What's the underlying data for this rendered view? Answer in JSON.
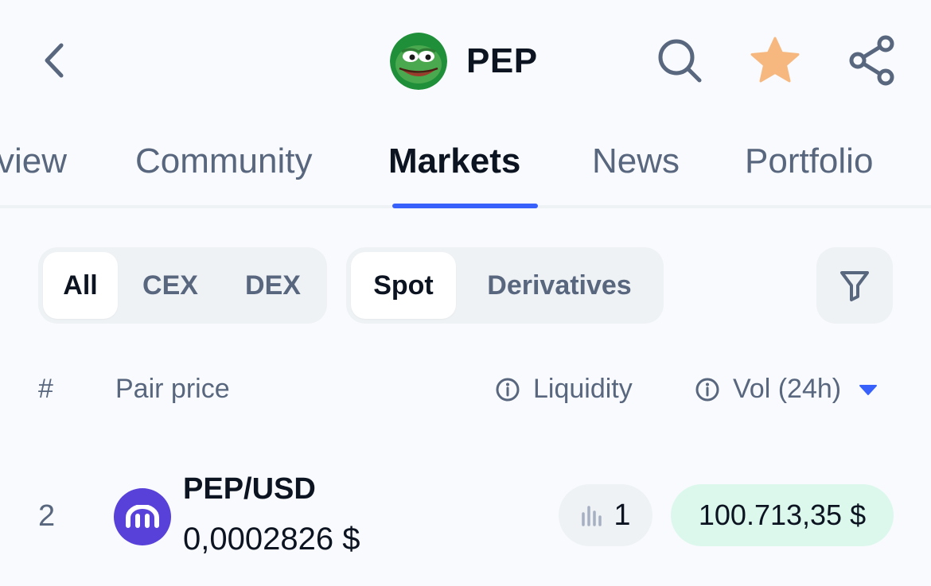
{
  "header": {
    "coin_symbol": "PEP"
  },
  "tabs": [
    {
      "label": "view",
      "active": false
    },
    {
      "label": "Community",
      "active": false
    },
    {
      "label": "Markets",
      "active": true
    },
    {
      "label": "News",
      "active": false
    },
    {
      "label": "Portfolio",
      "active": false
    }
  ],
  "filters": {
    "exchange_type": [
      "All",
      "CEX",
      "DEX"
    ],
    "exchange_type_selected": "All",
    "market_type": [
      "Spot",
      "Derivatives"
    ],
    "market_type_selected": "Spot"
  },
  "table": {
    "columns": {
      "rank": "#",
      "pair_price": "Pair price",
      "liquidity": "Liquidity",
      "volume": "Vol (24h)"
    },
    "sort": {
      "column": "volume",
      "direction": "desc"
    },
    "rows": [
      {
        "rank": "2",
        "pair": "PEP/USD",
        "price": "0,0002826 $",
        "liquidity": "1",
        "volume": "100.713,35 $"
      }
    ]
  },
  "colors": {
    "accent": "#3861fb",
    "star": "#f6b87e",
    "exchange_logo": "#5741d9",
    "volume_badge": "#dcf8ec"
  },
  "icons": [
    "back-icon",
    "pepe-logo",
    "search-icon",
    "star-icon",
    "share-icon",
    "filter-icon",
    "info-icon",
    "sort-desc-icon",
    "kraken-logo",
    "liquidity-bars-icon"
  ]
}
